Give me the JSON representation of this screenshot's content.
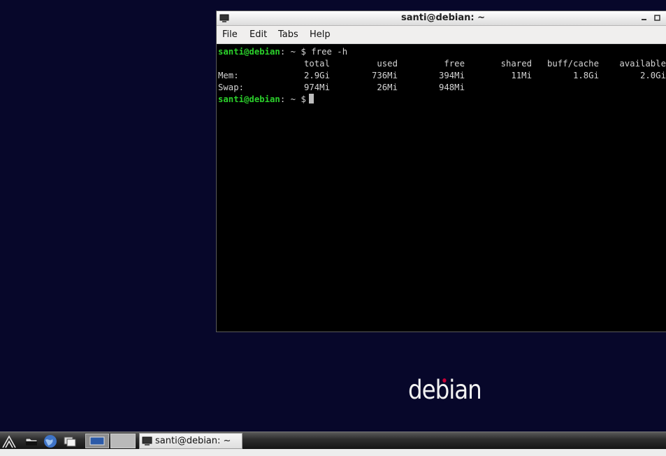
{
  "desktop": {
    "logo_text": "debian"
  },
  "window": {
    "title": "santi@debian: ~",
    "menu": [
      "File",
      "Edit",
      "Tabs",
      "Help"
    ]
  },
  "terminal": {
    "prompt_user": "santi@debian",
    "prompt_sep": ": ~ $",
    "command": "free -h",
    "headers": [
      "total",
      "used",
      "free",
      "shared",
      "buff/cache",
      "available"
    ],
    "rows": [
      {
        "label": "Mem:",
        "values": [
          "2.9Gi",
          "736Mi",
          "394Mi",
          "11Mi",
          "1.8Gi",
          "2.0Gi"
        ]
      },
      {
        "label": "Swap:",
        "values": [
          "974Mi",
          "26Mi",
          "948Mi",
          "",
          "",
          ""
        ]
      }
    ]
  },
  "taskbar": {
    "task_label": "santi@debian: ~",
    "launcher_icons": [
      "start-menu-icon",
      "file-manager-icon",
      "web-browser-icon",
      "show-desktop-icon"
    ]
  }
}
